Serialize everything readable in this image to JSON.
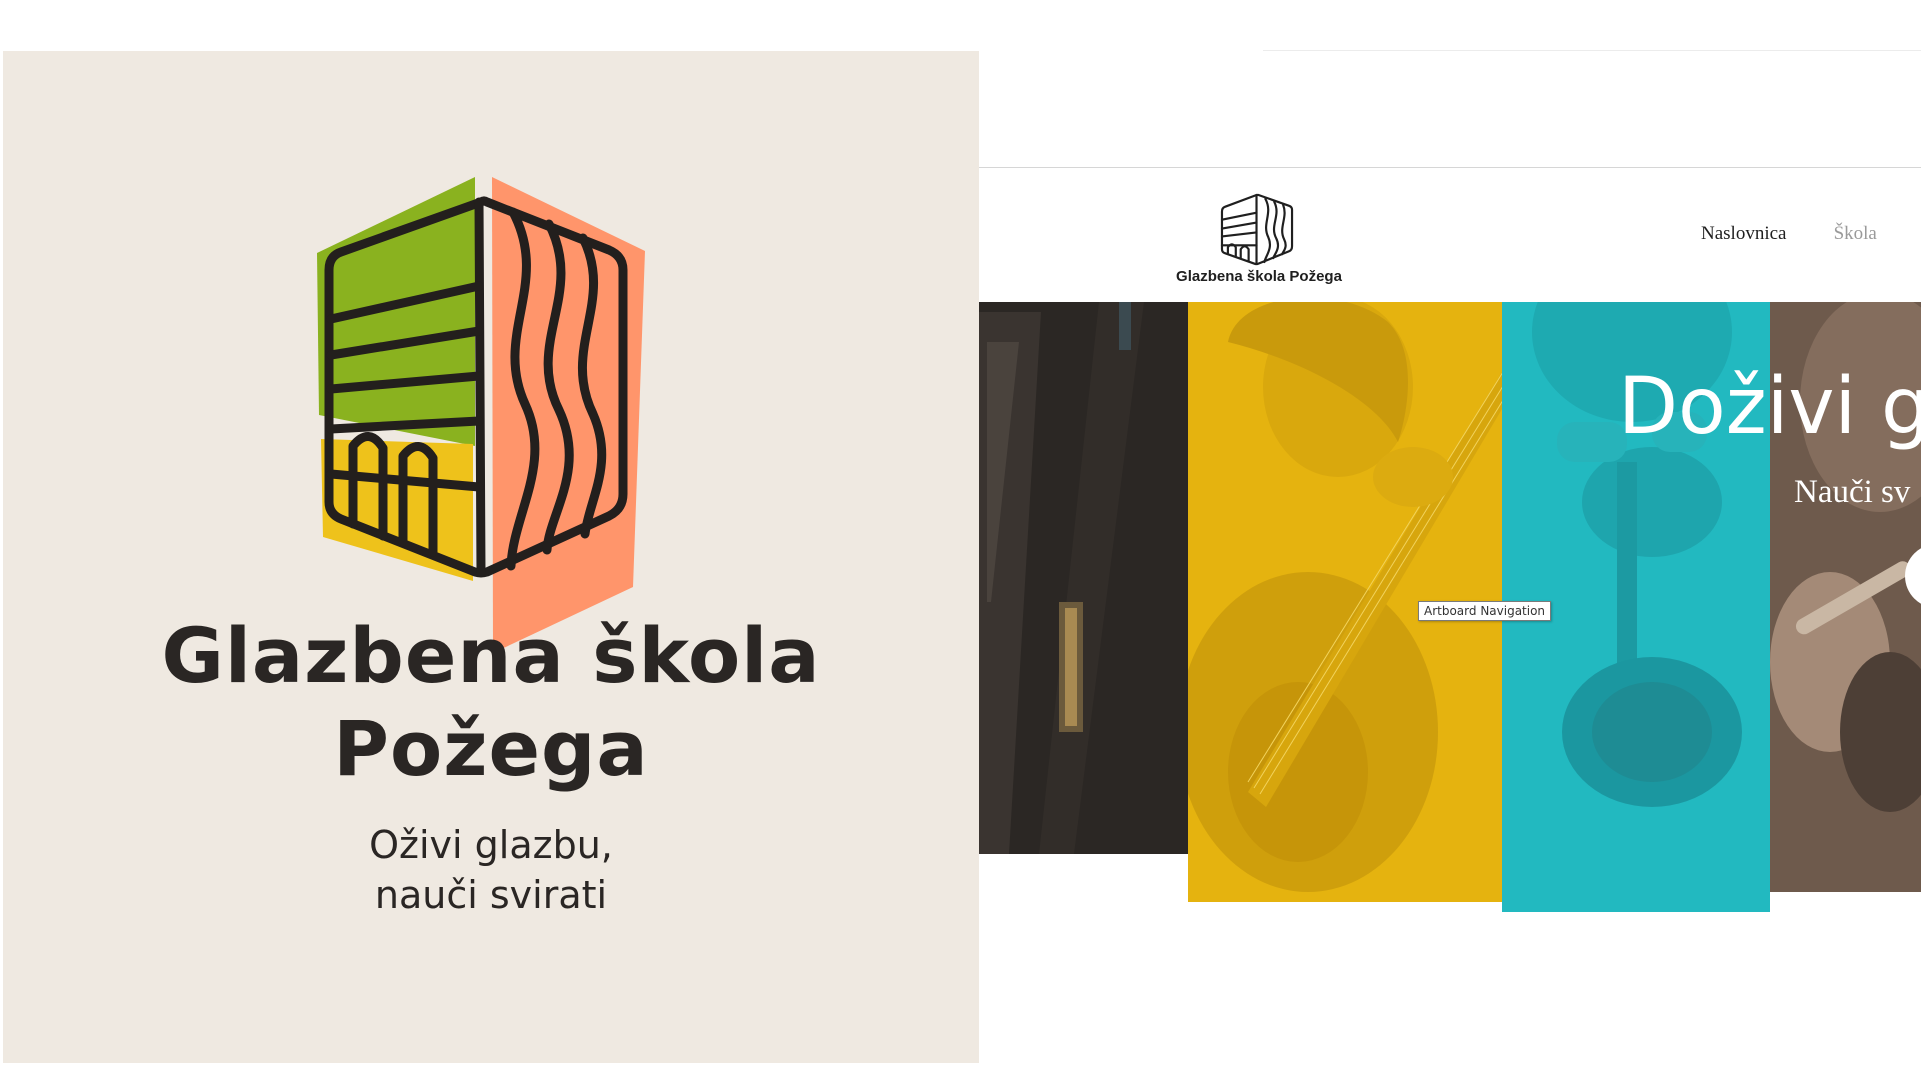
{
  "brand": {
    "title_line1": "Glazbena škola",
    "title_line2": "Požega",
    "tagline_line1": "Oživi glazbu,",
    "tagline_line2": "nauči svirati",
    "logo_icon": "school-building-icon",
    "colors": {
      "background": "#efe9e1",
      "green": "#8ab21f",
      "orange": "#ff956b",
      "yellow": "#eec21b",
      "ink": "#2a2624"
    }
  },
  "site": {
    "logo_text": "Glazbena škola Požega",
    "nav": [
      {
        "label": "Naslovnica"
      },
      {
        "label": "Škola"
      }
    ],
    "hero": {
      "title": "Doživi g",
      "subtitle": "Nauči sv"
    },
    "colors": {
      "strip_yellow": "#e5b30f",
      "strip_teal": "#22b9c0",
      "strip_dark": "#2b2724"
    }
  },
  "tooltip": "Artboard Navigation"
}
